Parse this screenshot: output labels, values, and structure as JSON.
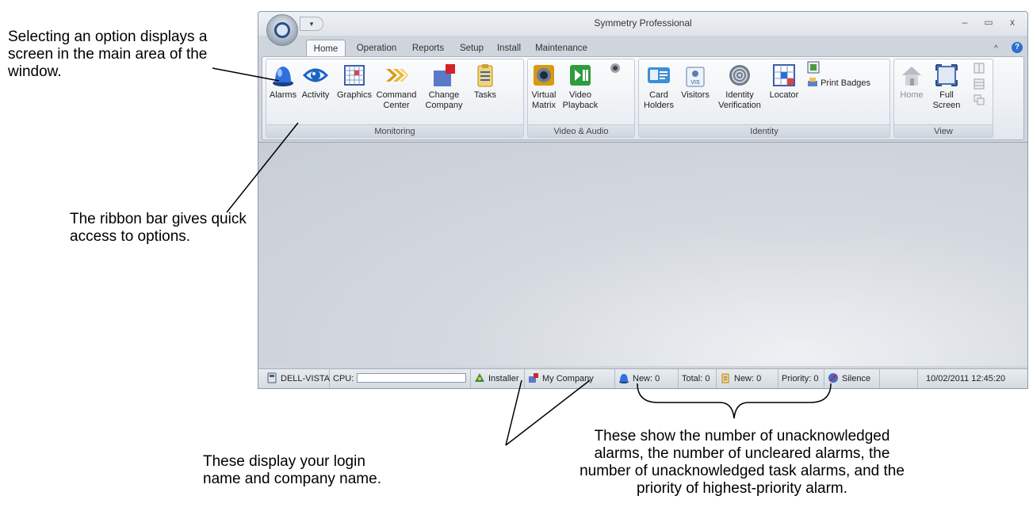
{
  "annotations": {
    "top": "Selecting an option displays a screen in the main area of the window.",
    "ribbon": "The ribbon bar gives quick access to options.",
    "login": "These display your login name and company name.",
    "alarms": "These show the number of unacknowledged alarms, the number of uncleared alarms, the number of unacknowledged task alarms, and the priority of highest-priority alarm."
  },
  "window": {
    "title": "Symmetry Professional",
    "qat_glyph": "▾",
    "min_glyph": "–",
    "max_glyph": "▭",
    "close_glyph": "x",
    "ribbon_minimize_glyph": "^",
    "help_glyph": "?"
  },
  "tabs": [
    "Home",
    "Operation",
    "Reports",
    "Setup",
    "Install",
    "Maintenance"
  ],
  "ribbon": {
    "groups": [
      {
        "label": "Monitoring",
        "buttons": [
          {
            "label": "Alarms",
            "icon": "alarm-beacon-icon"
          },
          {
            "label": "Activity",
            "icon": "eye-icon"
          },
          {
            "label": "Graphics",
            "icon": "grid-graphics-icon"
          },
          {
            "label": "Command Center",
            "icon": "chevrons-icon"
          },
          {
            "label": "Change Company",
            "icon": "company-icon"
          },
          {
            "label": "Tasks",
            "icon": "clipboard-icon"
          }
        ]
      },
      {
        "label": "Video & Audio",
        "buttons": [
          {
            "label": "Virtual Matrix",
            "icon": "camera-lens-icon"
          },
          {
            "label": "Video Playback",
            "icon": "play-pause-icon"
          },
          {
            "label": "",
            "icon": "speaker-icon"
          }
        ]
      },
      {
        "label": "Identity",
        "buttons": [
          {
            "label": "Card Holders",
            "icon": "id-card-icon"
          },
          {
            "label": "Visitors",
            "icon": "visitor-badge-icon"
          },
          {
            "label": "Identity Verification",
            "icon": "fingerprint-icon"
          },
          {
            "label": "Locator",
            "icon": "locator-grid-icon"
          },
          {
            "label": "Print Badges",
            "icon": "print-badges-icon"
          }
        ]
      },
      {
        "label": "View",
        "buttons": [
          {
            "label": "Home",
            "icon": "home-icon"
          },
          {
            "label": "Full Screen",
            "icon": "full-screen-icon"
          }
        ]
      }
    ]
  },
  "status": {
    "computer": "DELL-VISTA",
    "cpu_label": "CPU:",
    "cpu_level": 0.0,
    "user": "Installer",
    "company": "My Company",
    "alarms_new": "New: 0",
    "alarms_total": "Total: 0",
    "tasks_new": "New: 0",
    "priority": "Priority: 0",
    "silence": "Silence",
    "datetime": "10/02/2011 12:45:20"
  }
}
